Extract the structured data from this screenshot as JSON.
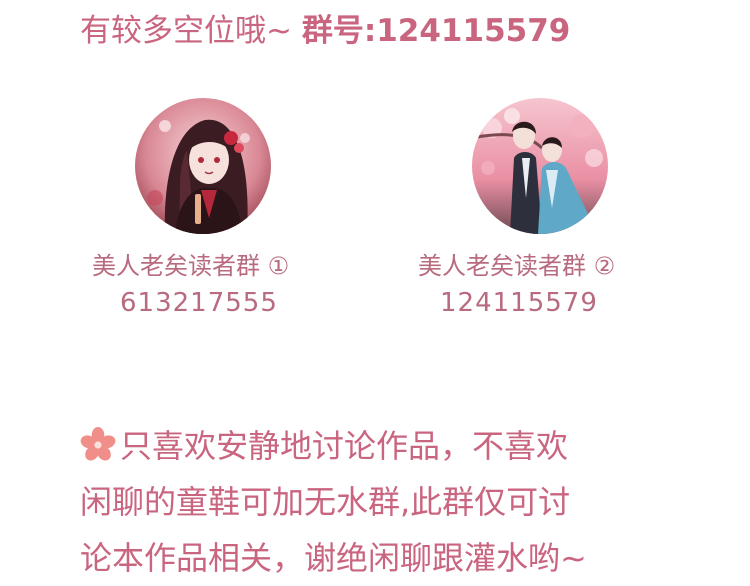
{
  "header": {
    "text": "有较多空位哦~ ",
    "group_label": "群号:124115579"
  },
  "groups": [
    {
      "name": "美人老矣读者群 ①",
      "id": "613217555",
      "avatar_icon": "anime-girl-red-hair-avatar"
    },
    {
      "name": "美人老矣读者群 ②",
      "id": "124115579",
      "avatar_icon": "anime-couple-cherry-blossom-avatar"
    }
  ],
  "notice": {
    "icon": "cherry-blossom-icon",
    "lines": [
      "只喜欢安静地讨论作品，不喜欢",
      "闲聊的童鞋可加无水群,此群仅可讨",
      "论本作品相关，谢绝闲聊跟灌水哟~"
    ]
  },
  "colors": {
    "accent": "#c9657f",
    "label": "#b86a7e",
    "flower": "#f08f8a"
  }
}
